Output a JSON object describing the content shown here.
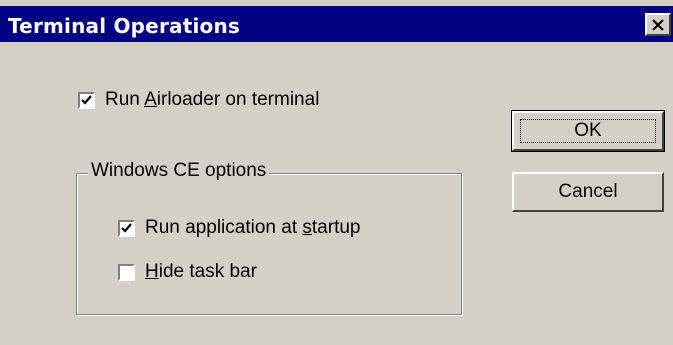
{
  "window": {
    "title": "Terminal Operations",
    "close_glyph": "✕"
  },
  "options": {
    "run_airloader": {
      "pre": "Run ",
      "accel": "A",
      "post": "irloader on terminal",
      "checked": true
    }
  },
  "group": {
    "legend": "Windows CE options",
    "run_at_startup": {
      "pre": "Run application at ",
      "accel": "s",
      "post": "tartup",
      "checked": true
    },
    "hide_taskbar": {
      "pre": "",
      "accel": "H",
      "post": "ide task bar",
      "checked": false
    }
  },
  "buttons": {
    "ok": "OK",
    "cancel": "Cancel"
  },
  "colors": {
    "titlebar": "#000080",
    "face": "#d4d0c8"
  }
}
